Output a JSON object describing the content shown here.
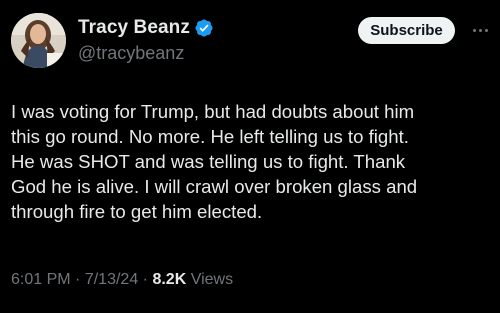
{
  "author": {
    "display_name": "Tracy Beanz",
    "handle": "@tracybeanz",
    "verified": true,
    "verified_color": "#1d9bf0"
  },
  "actions": {
    "subscribe_label": "Subscribe",
    "more_icon": "more-horizontal-icon"
  },
  "tweet": {
    "lines": [
      "I was voting for Trump, but had doubts about him",
      "this go round. No more. He left telling us to fight.",
      "He was SHOT and was telling us to fight. Thank",
      "God he is alive. I will crawl over broken glass and",
      "through fire to get him elected."
    ]
  },
  "meta": {
    "time": "6:01 PM",
    "separator": "·",
    "date": "7/13/24",
    "views_count": "8.2K",
    "views_label": "Views"
  },
  "colors": {
    "background": "#000000",
    "text_primary": "#e7e9ea",
    "text_secondary": "#71767b",
    "button_bg": "#eff3f4"
  }
}
